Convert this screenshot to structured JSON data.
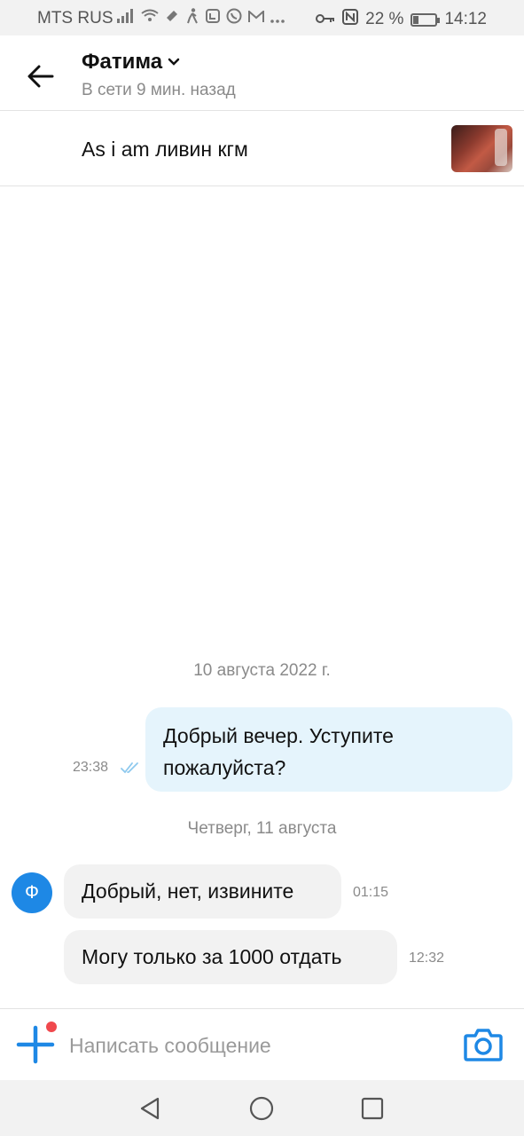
{
  "status_bar": {
    "carrier": "MTS RUS",
    "battery": "22 %",
    "battery_level": 0.22,
    "time": "14:12",
    "icons": [
      "signal-icon",
      "wifi-icon",
      "nfc-mute-icon",
      "walk-icon",
      "app-icon",
      "whatsapp-icon",
      "gmail-icon",
      "more-icon",
      "key-icon",
      "nfc-icon",
      "battery-icon"
    ]
  },
  "header": {
    "name": "Фатима",
    "status": "В сети 9 мин. назад"
  },
  "ad": {
    "title": "As i am ливин кгм"
  },
  "messages": {
    "date1": "10 августа 2022 г.",
    "out1": {
      "line1": "Добрый вечер. Уступите",
      "line2": "пожалуйста?",
      "time": "23:38"
    },
    "date2": "Четверг, 11 августа",
    "avatar_letter": "Ф",
    "in1": {
      "text": "Добрый, нет, извините",
      "time": "01:15"
    },
    "in2": {
      "text": "Могу только за 1000 отдать",
      "time": "12:32"
    }
  },
  "composer": {
    "placeholder": "Написать сообщение"
  },
  "colors": {
    "accent": "#1e88e5",
    "outgoing_bubble": "#e5f4fc",
    "incoming_bubble": "#f2f2f2",
    "notification_dot": "#f0484d"
  }
}
